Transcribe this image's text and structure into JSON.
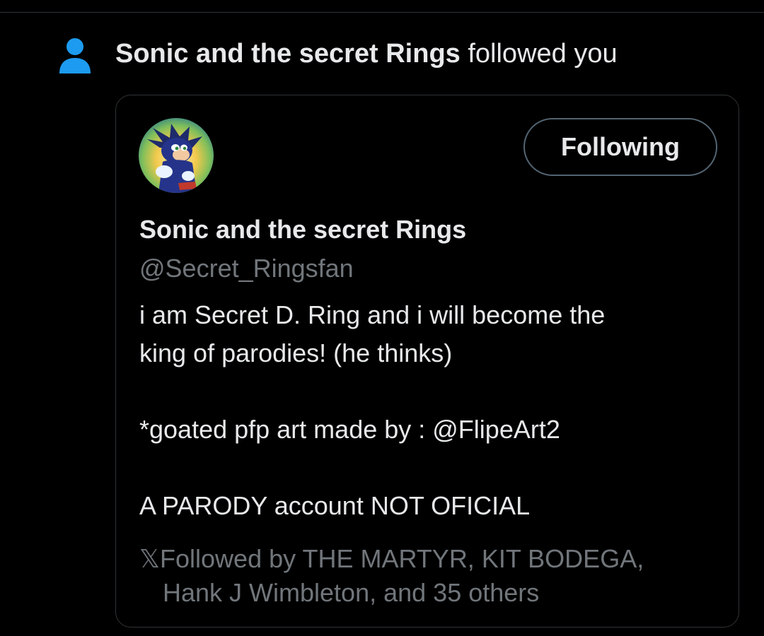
{
  "notification": {
    "icon": "person-icon",
    "actor": "Sonic and the secret Rings",
    "action": " followed you"
  },
  "colors": {
    "background": "#000000",
    "text_primary": "#e7e9ea",
    "text_secondary": "#71767b",
    "accent": "#1d9bf0",
    "border": "#2f3336"
  },
  "profile_card": {
    "avatar": "sonic-avatar-image",
    "follow_button_label": "Following",
    "display_name": "Sonic and the secret Rings",
    "handle": "@Secret_Ringsfan",
    "bio": {
      "line1": "i am Secret D. Ring and i will become the",
      "line2": "king of parodies! (he thinks)",
      "line3_prefix": "*goated pfp art made by : ",
      "line3_mention": " @FlipeArt2",
      "line4": "A PARODY account NOT OFICIAL"
    },
    "followed_by": {
      "icon": "x-logo-icon",
      "icon_glyph": "𝕏",
      "line1": "Followed by THE MARTYR, KIT BODEGA,",
      "line2": "Hank J Wimbleton, and 35 others"
    }
  }
}
